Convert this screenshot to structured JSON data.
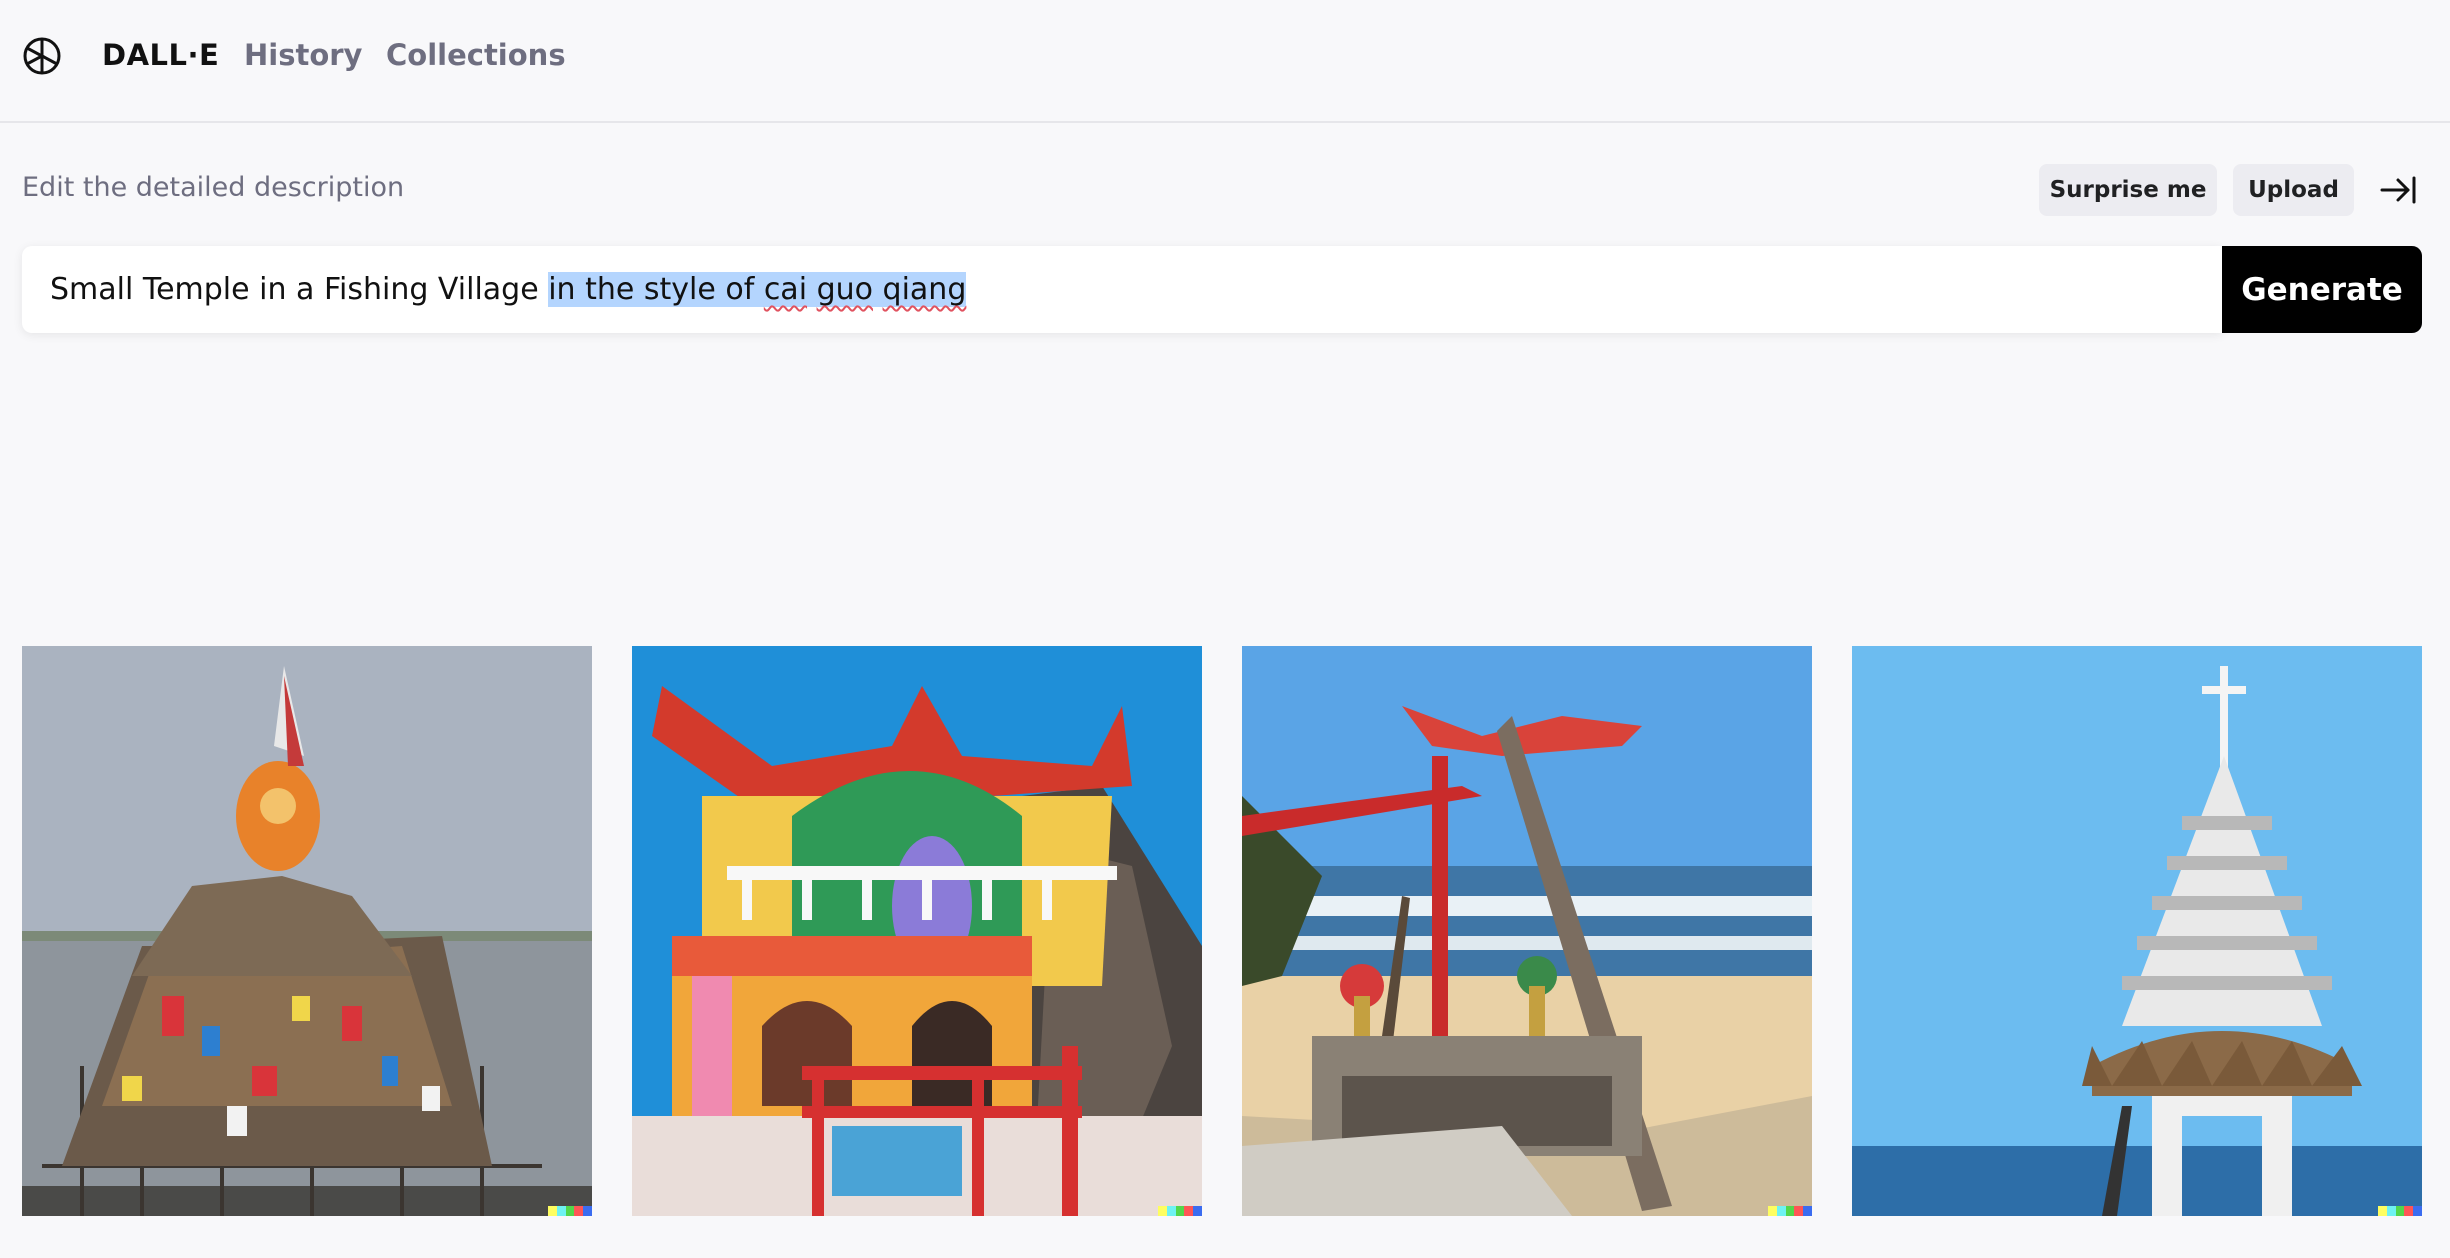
{
  "header": {
    "brand": "DALL·E",
    "nav": [
      {
        "label": "History"
      },
      {
        "label": "Collections"
      }
    ]
  },
  "prompt_area": {
    "label": "Edit the detailed description",
    "surprise_label": "Surprise me",
    "upload_label": "Upload",
    "prompt_plain": "Small Temple in a Fishing Village ",
    "prompt_selected_1": "in the style of ",
    "prompt_selected_2": "cai",
    "prompt_selected_3": " ",
    "prompt_selected_4": "guo",
    "prompt_selected_5": " ",
    "prompt_selected_6": "qiang",
    "generate_label": "Generate"
  },
  "icons": {
    "logo": "openai-logo-icon",
    "collapse": "collapse-arrow-icon"
  },
  "colors": {
    "generate_bg": "#000000",
    "selection": "#b4d5fe",
    "pill_bg": "#ececf1"
  },
  "gallery": [
    {
      "name": "image-1"
    },
    {
      "name": "image-2"
    },
    {
      "name": "image-3"
    },
    {
      "name": "image-4"
    }
  ]
}
